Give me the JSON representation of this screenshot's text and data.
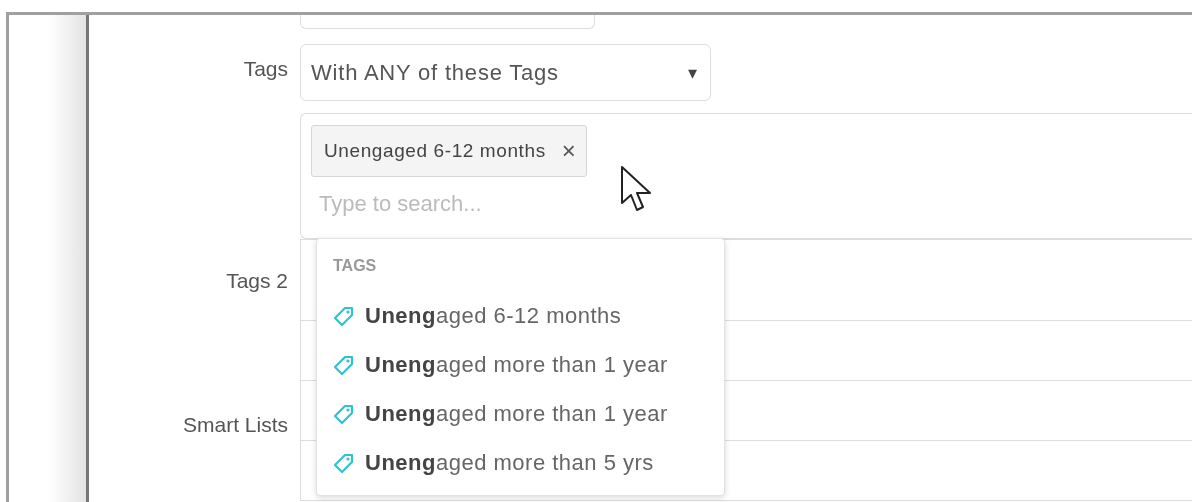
{
  "tags_filter": {
    "label": "Tags",
    "value": "With ANY of these Tags",
    "caret": "▾"
  },
  "tag_input": {
    "chips": [
      {
        "label": "Unengaged 6-12 months",
        "remove": "×"
      }
    ],
    "placeholder": "Type to search..."
  },
  "dropdown": {
    "header": "TAGS",
    "items": [
      {
        "text": "**Uneng**aged 6-12 months"
      },
      {
        "text": "**Uneng**aged more than 1 year"
      },
      {
        "text": "**Uneng**aged more than 1 year"
      },
      {
        "text": "**Uneng**aged more than 5 yrs"
      }
    ]
  },
  "fields": [
    {
      "label": "Tags 2"
    },
    {
      "label": "Smart Lists"
    }
  ]
}
